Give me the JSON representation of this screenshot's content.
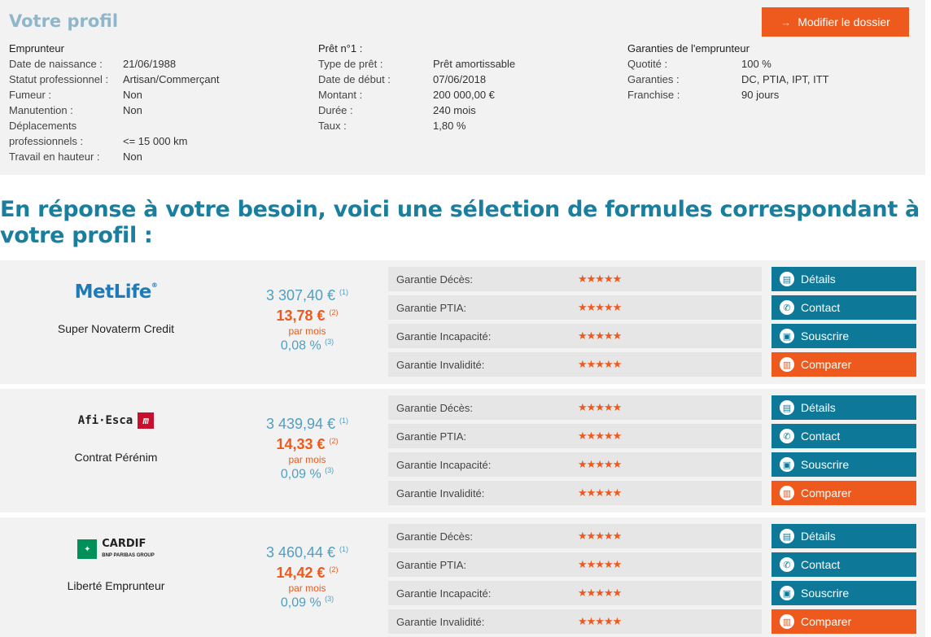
{
  "profile": {
    "title": "Votre profil",
    "edit_button": "Modifier le dossier",
    "borrower": {
      "heading": "Emprunteur",
      "rows": [
        {
          "label": "Date de naissance :",
          "value": "21/06/1988"
        },
        {
          "label": "Statut professionnel :",
          "value": "Artisan/Commerçant"
        },
        {
          "label": "Fumeur :",
          "value": "Non"
        },
        {
          "label": "Manutention :",
          "value": "Non"
        },
        {
          "label": "Déplacements",
          "value": ""
        },
        {
          "label": "professionnels :",
          "value": "<= 15 000 km"
        },
        {
          "label": "Travail en hauteur :",
          "value": "Non"
        }
      ]
    },
    "loan": {
      "heading": "Prêt n°1 :",
      "rows": [
        {
          "label": "Type de prêt :",
          "value": "Prêt amortissable"
        },
        {
          "label": "Date de début :",
          "value": "07/06/2018"
        },
        {
          "label": "Montant :",
          "value": "200 000,00 €"
        },
        {
          "label": "Durée :",
          "value": "240 mois"
        },
        {
          "label": "Taux :",
          "value": "1,80 %"
        }
      ]
    },
    "guarantees": {
      "heading": "Garanties de l'emprunteur",
      "rows": [
        {
          "label": "Quotité :",
          "value": "100 %"
        },
        {
          "label": "Garanties :",
          "value": "DC, PTIA, IPT, ITT"
        },
        {
          "label": "Franchise :",
          "value": "90 jours"
        }
      ]
    }
  },
  "headline": "En réponse à votre besoin, voici une sélection de formules correspondant à votre profil :",
  "guarantee_labels": [
    "Garantie Décès:",
    "Garantie PTIA:",
    "Garantie Incapacité:",
    "Garantie Invalidité:"
  ],
  "stars": "★★★★★",
  "actions": [
    "Détails",
    "Contact",
    "Souscrire",
    "Comparer"
  ],
  "offers": [
    {
      "insurer": "MetLife",
      "product": "Super Novaterm Credit",
      "total": "3 307,40 €",
      "total_note": "(1)",
      "monthly": "13,78 €",
      "monthly_note": "(2)",
      "per_month": "par mois",
      "rate": "0,08 %",
      "rate_note": "(3)"
    },
    {
      "insurer": "Afi·Esca",
      "product": "Contrat Pérénim",
      "total": "3 439,94 €",
      "total_note": "(1)",
      "monthly": "14,33 €",
      "monthly_note": "(2)",
      "per_month": "par mois",
      "rate": "0,09 %",
      "rate_note": "(3)"
    },
    {
      "insurer": "CARDIF",
      "insurer_sub": "BNP PARIBAS GROUP",
      "product": "Liberté Emprunteur",
      "total": "3 460,44 €",
      "total_note": "(1)",
      "monthly": "14,42 €",
      "monthly_note": "(2)",
      "per_month": "par mois",
      "rate": "0,09 %",
      "rate_note": "(3)"
    }
  ],
  "colors": {
    "accent_orange": "#ee5a1e",
    "accent_blue": "#0e7898",
    "headline_blue": "#1a7f9e",
    "price_blue": "#4f9fc2"
  }
}
